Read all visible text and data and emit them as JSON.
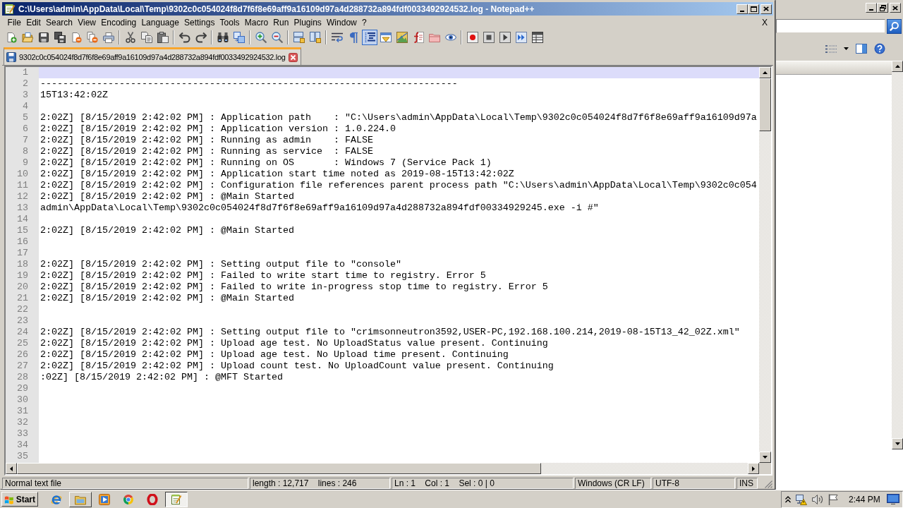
{
  "window": {
    "title": "C:\\Users\\admin\\AppData\\Local\\Temp\\9302c0c054024f8d7f6f8e69aff9a16109d97a4d288732a894fdf0033492924532.log - Notepad++"
  },
  "menu": [
    "File",
    "Edit",
    "Search",
    "View",
    "Encoding",
    "Language",
    "Settings",
    "Tools",
    "Macro",
    "Run",
    "Plugins",
    "Window",
    "?"
  ],
  "menu_close": "X",
  "toolbar": [
    {
      "pressed": false,
      "disabled": false
    },
    {
      "pressed": false,
      "disabled": false
    },
    {
      "pressed": false,
      "disabled": true
    },
    {
      "pressed": false,
      "disabled": true
    },
    {
      "pressed": false,
      "disabled": false
    },
    {
      "pressed": false,
      "disabled": false
    },
    {
      "pressed": false,
      "disabled": false
    },
    {
      "pressed": false,
      "disabled": true
    },
    {
      "pressed": false,
      "disabled": true
    },
    {
      "pressed": false,
      "disabled": true
    },
    {
      "pressed": false,
      "disabled": true
    },
    {
      "pressed": false,
      "disabled": true
    },
    {
      "pressed": false,
      "disabled": false
    },
    {
      "pressed": false,
      "disabled": false
    },
    {
      "pressed": false,
      "disabled": false
    },
    {
      "pressed": false,
      "disabled": false
    },
    {
      "pressed": false,
      "disabled": false
    },
    {
      "pressed": false,
      "disabled": false
    },
    {
      "pressed": false,
      "disabled": false
    },
    {
      "pressed": false,
      "disabled": false
    },
    {
      "pressed": true,
      "disabled": false
    },
    {
      "pressed": false,
      "disabled": false
    },
    {
      "pressed": false,
      "disabled": false
    },
    {
      "pressed": false,
      "disabled": false
    },
    {
      "pressed": false,
      "disabled": false
    },
    {
      "pressed": false,
      "disabled": false
    },
    {
      "pressed": false,
      "disabled": false
    },
    {
      "pressed": false,
      "disabled": true
    },
    {
      "pressed": false,
      "disabled": true
    },
    {
      "pressed": false,
      "disabled": false
    },
    {
      "pressed": false,
      "disabled": true
    }
  ],
  "tabs": [
    {
      "label": "9302c0c054024f8d7f6f8e69aff9a16109d97a4d288732a894fdf0033492924532.log",
      "selected": true
    }
  ],
  "editor": {
    "lines": [
      {
        "number": "1",
        "current": true
      },
      {
        "number": "2",
        "current": false,
        "text": "--------------------------------------------------------------------------"
      },
      {
        "number": "3",
        "current": false,
        "text": "15T13:42:02Z"
      },
      {
        "number": "4",
        "current": false
      },
      {
        "number": "5",
        "current": false,
        "text": "2:02Z] [8/15/2019 2:42:02 PM] : Application path    : \"C:\\Users\\admin\\AppData\\Local\\Temp\\9302c0c054024f8d7f6f8e69aff9a16109d97a"
      },
      {
        "number": "6",
        "current": false,
        "text": "2:02Z] [8/15/2019 2:42:02 PM] : Application version : 1.0.224.0"
      },
      {
        "number": "7",
        "current": false,
        "text": "2:02Z] [8/15/2019 2:42:02 PM] : Running as admin    : FALSE"
      },
      {
        "number": "8",
        "current": false,
        "text": "2:02Z] [8/15/2019 2:42:02 PM] : Running as service  : FALSE"
      },
      {
        "number": "9",
        "current": false,
        "text": "2:02Z] [8/15/2019 2:42:02 PM] : Running on OS       : Windows 7 (Service Pack 1)"
      },
      {
        "number": "10",
        "current": false,
        "text": "2:02Z] [8/15/2019 2:42:02 PM] : Application start time noted as 2019-08-15T13:42:02Z"
      },
      {
        "number": "11",
        "current": false,
        "text": "2:02Z] [8/15/2019 2:42:02 PM] : Configuration file references parent process path \"C:\\Users\\admin\\AppData\\Local\\Temp\\9302c0c054"
      },
      {
        "number": "12",
        "current": false,
        "text": "2:02Z] [8/15/2019 2:42:02 PM] : @Main Started"
      },
      {
        "number": "13",
        "current": false,
        "text": "admin\\AppData\\Local\\Temp\\9302c0c054024f8d7f6f8e69aff9a16109d97a4d288732a894fdf00334929245.exe -i #\""
      },
      {
        "number": "14",
        "current": false
      },
      {
        "number": "15",
        "current": false,
        "text": "2:02Z] [8/15/2019 2:42:02 PM] : @Main Started"
      },
      {
        "number": "16",
        "current": false
      },
      {
        "number": "17",
        "current": false
      },
      {
        "number": "18",
        "current": false,
        "text": "2:02Z] [8/15/2019 2:42:02 PM] : Setting output file to \"console\""
      },
      {
        "number": "19",
        "current": false,
        "text": "2:02Z] [8/15/2019 2:42:02 PM] : Failed to write start time to registry. Error 5"
      },
      {
        "number": "20",
        "current": false,
        "text": "2:02Z] [8/15/2019 2:42:02 PM] : Failed to write in-progress stop time to registry. Error 5"
      },
      {
        "number": "21",
        "current": false,
        "text": "2:02Z] [8/15/2019 2:42:02 PM] : @Main Started"
      },
      {
        "number": "22",
        "current": false
      },
      {
        "number": "23",
        "current": false
      },
      {
        "number": "24",
        "current": false,
        "text": "2:02Z] [8/15/2019 2:42:02 PM] : Setting output file to \"crimsonneutron3592,USER-PC,192.168.100.214,2019-08-15T13_42_02Z.xml\""
      },
      {
        "number": "25",
        "current": false,
        "text": "2:02Z] [8/15/2019 2:42:02 PM] : Upload age test. No UploadStatus value present. Continuing"
      },
      {
        "number": "26",
        "current": false,
        "text": "2:02Z] [8/15/2019 2:42:02 PM] : Upload age test. No Upload time present. Continuing"
      },
      {
        "number": "27",
        "current": false,
        "text": "2:02Z] [8/15/2019 2:42:02 PM] : Upload count test. No UploadCount value present. Continuing"
      },
      {
        "number": "28",
        "current": false,
        "text": ":02Z] [8/15/2019 2:42:02 PM] : @MFT Started"
      },
      {
        "number": "29",
        "current": false
      },
      {
        "number": "30",
        "current": false
      },
      {
        "number": "31",
        "current": false
      },
      {
        "number": "32",
        "current": false
      },
      {
        "number": "33",
        "current": false
      },
      {
        "number": "34",
        "current": false
      },
      {
        "number": "35",
        "current": false
      }
    ]
  },
  "status_bar": {
    "file_type": "Normal text file",
    "size": "length : 12,717    lines : 246",
    "position": "Ln : 1    Col : 1    Sel : 0 | 0",
    "eol": "Windows (CR LF)",
    "encoding": "UTF-8",
    "mode": "INS"
  },
  "taskbar": {
    "start": "Start",
    "apps": [
      {
        "running": false,
        "selected": false
      },
      {
        "running": true,
        "selected": false
      },
      {
        "running": false,
        "selected": false
      },
      {
        "running": false,
        "selected": false
      },
      {
        "running": false,
        "selected": false
      },
      {
        "running": true,
        "selected": true
      }
    ],
    "clock": "2:44 PM"
  }
}
